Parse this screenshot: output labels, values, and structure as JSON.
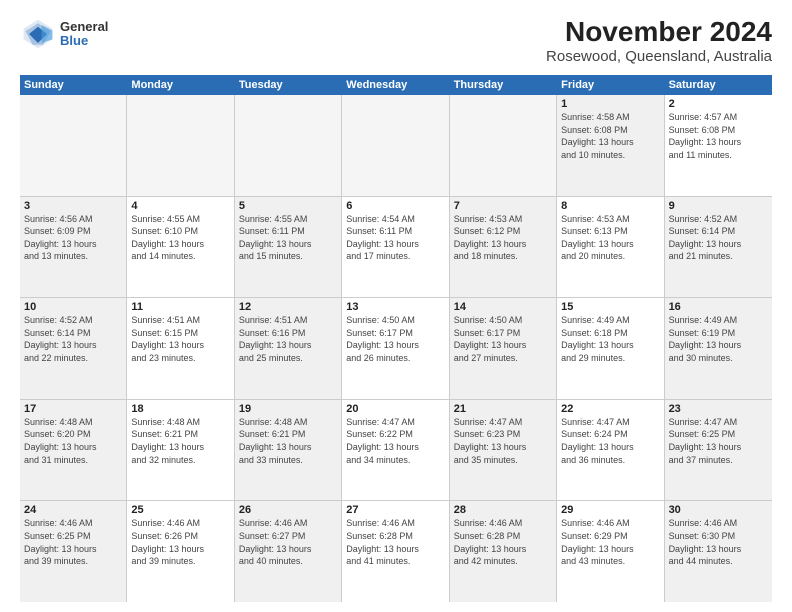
{
  "logo": {
    "general": "General",
    "blue": "Blue"
  },
  "title": "November 2024",
  "subtitle": "Rosewood, Queensland, Australia",
  "days": [
    "Sunday",
    "Monday",
    "Tuesday",
    "Wednesday",
    "Thursday",
    "Friday",
    "Saturday"
  ],
  "rows": [
    [
      {
        "day": "",
        "empty": true
      },
      {
        "day": "",
        "empty": true
      },
      {
        "day": "",
        "empty": true
      },
      {
        "day": "",
        "empty": true
      },
      {
        "day": "",
        "empty": true
      },
      {
        "day": "1",
        "info": "Sunrise: 4:58 AM\nSunset: 6:08 PM\nDaylight: 13 hours\nand 10 minutes.",
        "shaded": true
      },
      {
        "day": "2",
        "info": "Sunrise: 4:57 AM\nSunset: 6:08 PM\nDaylight: 13 hours\nand 11 minutes.",
        "shaded": false
      }
    ],
    [
      {
        "day": "3",
        "info": "Sunrise: 4:56 AM\nSunset: 6:09 PM\nDaylight: 13 hours\nand 13 minutes.",
        "shaded": true
      },
      {
        "day": "4",
        "info": "Sunrise: 4:55 AM\nSunset: 6:10 PM\nDaylight: 13 hours\nand 14 minutes.",
        "shaded": false
      },
      {
        "day": "5",
        "info": "Sunrise: 4:55 AM\nSunset: 6:11 PM\nDaylight: 13 hours\nand 15 minutes.",
        "shaded": true
      },
      {
        "day": "6",
        "info": "Sunrise: 4:54 AM\nSunset: 6:11 PM\nDaylight: 13 hours\nand 17 minutes.",
        "shaded": false
      },
      {
        "day": "7",
        "info": "Sunrise: 4:53 AM\nSunset: 6:12 PM\nDaylight: 13 hours\nand 18 minutes.",
        "shaded": true
      },
      {
        "day": "8",
        "info": "Sunrise: 4:53 AM\nSunset: 6:13 PM\nDaylight: 13 hours\nand 20 minutes.",
        "shaded": false
      },
      {
        "day": "9",
        "info": "Sunrise: 4:52 AM\nSunset: 6:14 PM\nDaylight: 13 hours\nand 21 minutes.",
        "shaded": true
      }
    ],
    [
      {
        "day": "10",
        "info": "Sunrise: 4:52 AM\nSunset: 6:14 PM\nDaylight: 13 hours\nand 22 minutes.",
        "shaded": true
      },
      {
        "day": "11",
        "info": "Sunrise: 4:51 AM\nSunset: 6:15 PM\nDaylight: 13 hours\nand 23 minutes.",
        "shaded": false
      },
      {
        "day": "12",
        "info": "Sunrise: 4:51 AM\nSunset: 6:16 PM\nDaylight: 13 hours\nand 25 minutes.",
        "shaded": true
      },
      {
        "day": "13",
        "info": "Sunrise: 4:50 AM\nSunset: 6:17 PM\nDaylight: 13 hours\nand 26 minutes.",
        "shaded": false
      },
      {
        "day": "14",
        "info": "Sunrise: 4:50 AM\nSunset: 6:17 PM\nDaylight: 13 hours\nand 27 minutes.",
        "shaded": true
      },
      {
        "day": "15",
        "info": "Sunrise: 4:49 AM\nSunset: 6:18 PM\nDaylight: 13 hours\nand 29 minutes.",
        "shaded": false
      },
      {
        "day": "16",
        "info": "Sunrise: 4:49 AM\nSunset: 6:19 PM\nDaylight: 13 hours\nand 30 minutes.",
        "shaded": true
      }
    ],
    [
      {
        "day": "17",
        "info": "Sunrise: 4:48 AM\nSunset: 6:20 PM\nDaylight: 13 hours\nand 31 minutes.",
        "shaded": true
      },
      {
        "day": "18",
        "info": "Sunrise: 4:48 AM\nSunset: 6:21 PM\nDaylight: 13 hours\nand 32 minutes.",
        "shaded": false
      },
      {
        "day": "19",
        "info": "Sunrise: 4:48 AM\nSunset: 6:21 PM\nDaylight: 13 hours\nand 33 minutes.",
        "shaded": true
      },
      {
        "day": "20",
        "info": "Sunrise: 4:47 AM\nSunset: 6:22 PM\nDaylight: 13 hours\nand 34 minutes.",
        "shaded": false
      },
      {
        "day": "21",
        "info": "Sunrise: 4:47 AM\nSunset: 6:23 PM\nDaylight: 13 hours\nand 35 minutes.",
        "shaded": true
      },
      {
        "day": "22",
        "info": "Sunrise: 4:47 AM\nSunset: 6:24 PM\nDaylight: 13 hours\nand 36 minutes.",
        "shaded": false
      },
      {
        "day": "23",
        "info": "Sunrise: 4:47 AM\nSunset: 6:25 PM\nDaylight: 13 hours\nand 37 minutes.",
        "shaded": true
      }
    ],
    [
      {
        "day": "24",
        "info": "Sunrise: 4:46 AM\nSunset: 6:25 PM\nDaylight: 13 hours\nand 39 minutes.",
        "shaded": true
      },
      {
        "day": "25",
        "info": "Sunrise: 4:46 AM\nSunset: 6:26 PM\nDaylight: 13 hours\nand 39 minutes.",
        "shaded": false
      },
      {
        "day": "26",
        "info": "Sunrise: 4:46 AM\nSunset: 6:27 PM\nDaylight: 13 hours\nand 40 minutes.",
        "shaded": true
      },
      {
        "day": "27",
        "info": "Sunrise: 4:46 AM\nSunset: 6:28 PM\nDaylight: 13 hours\nand 41 minutes.",
        "shaded": false
      },
      {
        "day": "28",
        "info": "Sunrise: 4:46 AM\nSunset: 6:28 PM\nDaylight: 13 hours\nand 42 minutes.",
        "shaded": true
      },
      {
        "day": "29",
        "info": "Sunrise: 4:46 AM\nSunset: 6:29 PM\nDaylight: 13 hours\nand 43 minutes.",
        "shaded": false
      },
      {
        "day": "30",
        "info": "Sunrise: 4:46 AM\nSunset: 6:30 PM\nDaylight: 13 hours\nand 44 minutes.",
        "shaded": true
      }
    ]
  ]
}
